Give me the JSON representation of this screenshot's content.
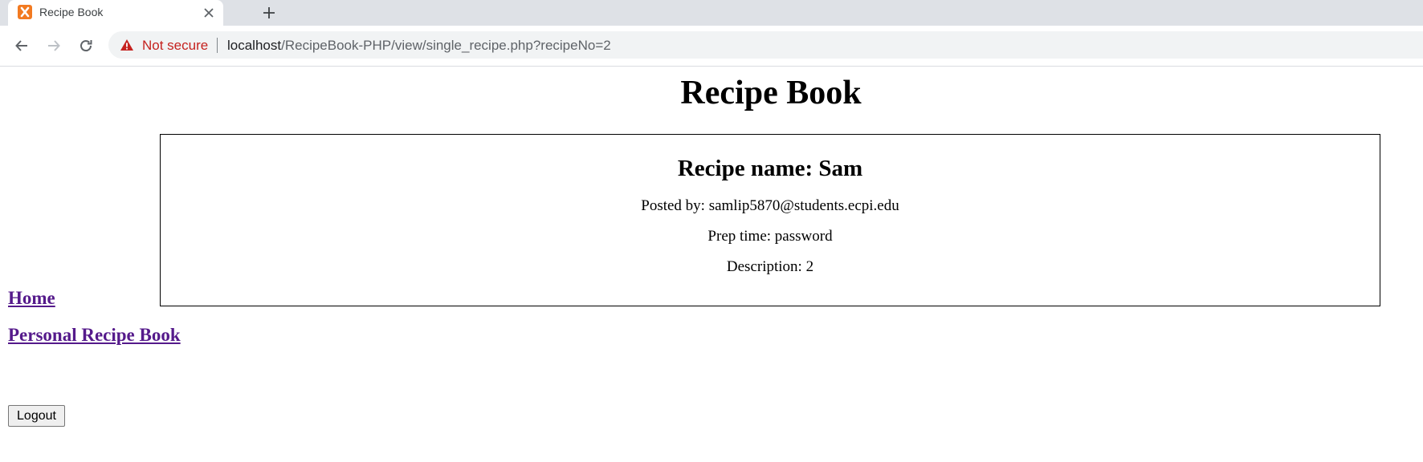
{
  "browser": {
    "tab": {
      "title": "Recipe Book",
      "favicon": "xampp-icon"
    },
    "address_bar": {
      "security_label": "Not secure",
      "url_host": "localhost",
      "url_path": "/RecipeBook-PHP/view/single_recipe.php?recipeNo=2"
    },
    "colors": {
      "tab_strip": "#dee1e6",
      "security_warning": "#c5221f"
    }
  },
  "page": {
    "title": "Recipe Book",
    "recipe": {
      "name_line": "Recipe name: Sam",
      "posted_by_line": "Posted by: samlip5870@students.ecpi.edu",
      "prep_time_line": "Prep time: password",
      "description_line": "Description: 2"
    },
    "links": {
      "home": "Home",
      "personal_recipe_book": "Personal Recipe Book"
    },
    "logout_label": "Logout",
    "colors": {
      "visited_link": "#551a8b"
    }
  }
}
